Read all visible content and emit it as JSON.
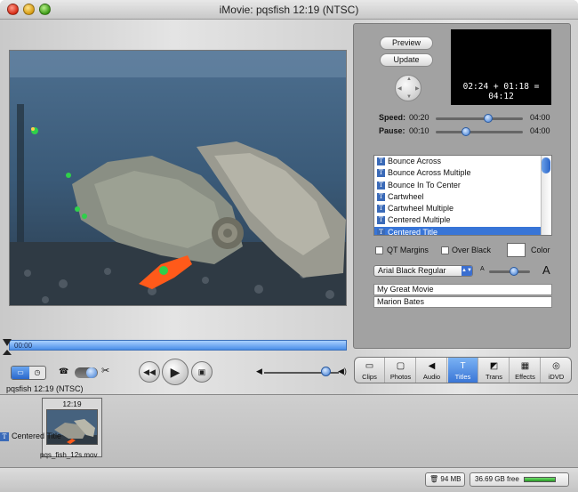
{
  "window": {
    "title": "iMovie: pqsfish  12:19 (NTSC)"
  },
  "editor": {
    "preview_label": "Preview",
    "update_label": "Update",
    "preview_time": "02:24 + 01:18 = 04:12",
    "speed": {
      "label": "Speed:",
      "value": "00:20",
      "max": "04:00",
      "level": 0.6
    },
    "pause": {
      "label": "Pause:",
      "value": "00:10",
      "max": "04:00",
      "level": 0.35
    },
    "titles": [
      "Bounce Across",
      "Bounce Across Multiple",
      "Bounce In To Center",
      "Cartwheel",
      "Cartwheel Multiple",
      "Centered Multiple",
      "Centered Title"
    ],
    "selected_title": "Centered Title",
    "qt_margins_label": "QT Margins",
    "over_black_label": "Over Black",
    "color_label": "Color",
    "font": "Arial Black Regular",
    "size_small": "A",
    "size_large": "A",
    "line1": "My Great Movie",
    "line2": "Marion Bates"
  },
  "scrubber": {
    "time": "00:00"
  },
  "controls": {
    "rewind_icon": "rewind-icon",
    "play_icon": "play-icon",
    "fullscreen_icon": "fullscreen-play-icon",
    "volume_level": 0.82
  },
  "tabs": [
    {
      "label": "Clips",
      "icon": "clips-icon"
    },
    {
      "label": "Photos",
      "icon": "photos-icon"
    },
    {
      "label": "Audio",
      "icon": "audio-icon"
    },
    {
      "label": "Titles",
      "icon": "titles-icon"
    },
    {
      "label": "Trans",
      "icon": "transitions-icon"
    },
    {
      "label": "Effects",
      "icon": "effects-icon"
    },
    {
      "label": "iDVD",
      "icon": "idvd-icon"
    }
  ],
  "active_tab": "Titles",
  "project": {
    "label": "pqsfish  12:19 (NTSC)"
  },
  "clip": {
    "duration": "12:19",
    "name": "pqs_fish_12s.mov",
    "title_overlay": "Centered Title"
  },
  "status": {
    "trash": "94 MB",
    "free": "36.69 GB free"
  },
  "colors": {
    "selection": "#3875d7",
    "accent": "#3a78d0"
  }
}
